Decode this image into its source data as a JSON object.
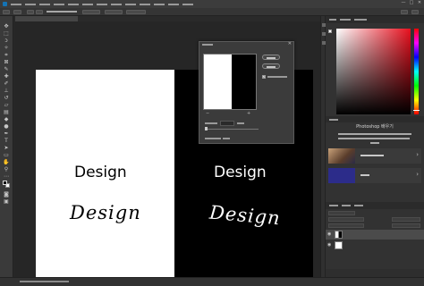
{
  "app": {
    "menu_items": [
      "",
      "",
      "",
      "",
      "",
      "",
      "",
      "",
      "",
      "",
      "",
      "",
      ""
    ],
    "window_controls": [
      "—",
      "□",
      "✕"
    ]
  },
  "document": {
    "tab_title": "",
    "zoom": "",
    "doc_info": ""
  },
  "canvas": {
    "left_text": "Design",
    "left_handwritten": "Design",
    "right_text": "Design",
    "right_handwritten": "Design",
    "colors": {
      "left_bg": "#ffffff",
      "right_bg": "#000000",
      "workspace": "#262626"
    }
  },
  "dialog": {
    "title": "",
    "ok_label": "",
    "cancel_label": "",
    "preview_label": "",
    "zoom_value": "",
    "field_label": "",
    "field_value": "",
    "field_unit": "",
    "footer_a": "",
    "footer_b": ""
  },
  "color_panel": {
    "tabs": [
      "",
      "",
      ""
    ],
    "hue_color": "#e8101e"
  },
  "learn_panel": {
    "title": "Photoshop 배우기",
    "description_lines": [
      "",
      "",
      ""
    ],
    "cards": [
      {
        "label": "",
        "icon": "portrait-thumbnail"
      },
      {
        "label": "",
        "icon": "tips-thumbnail"
      }
    ]
  },
  "layers_panel": {
    "tabs": [
      "",
      "",
      ""
    ],
    "layers": [
      {
        "name": "",
        "visible": true,
        "thumb": "half-white-half-black",
        "selected": true
      },
      {
        "name": "",
        "visible": true,
        "thumb": "white",
        "selected": false
      }
    ]
  },
  "tools": {
    "icons": [
      "move-icon",
      "marquee-icon",
      "lasso-icon",
      "magic-wand-icon",
      "crop-icon",
      "frame-icon",
      "eyedropper-icon",
      "healing-brush-icon",
      "brush-icon",
      "clone-stamp-icon",
      "history-brush-icon",
      "eraser-icon",
      "gradient-icon",
      "blur-icon",
      "dodge-icon",
      "pen-icon",
      "type-icon",
      "path-selection-icon",
      "rectangle-icon",
      "hand-icon",
      "zoom-icon",
      "more-tools-icon"
    ]
  }
}
